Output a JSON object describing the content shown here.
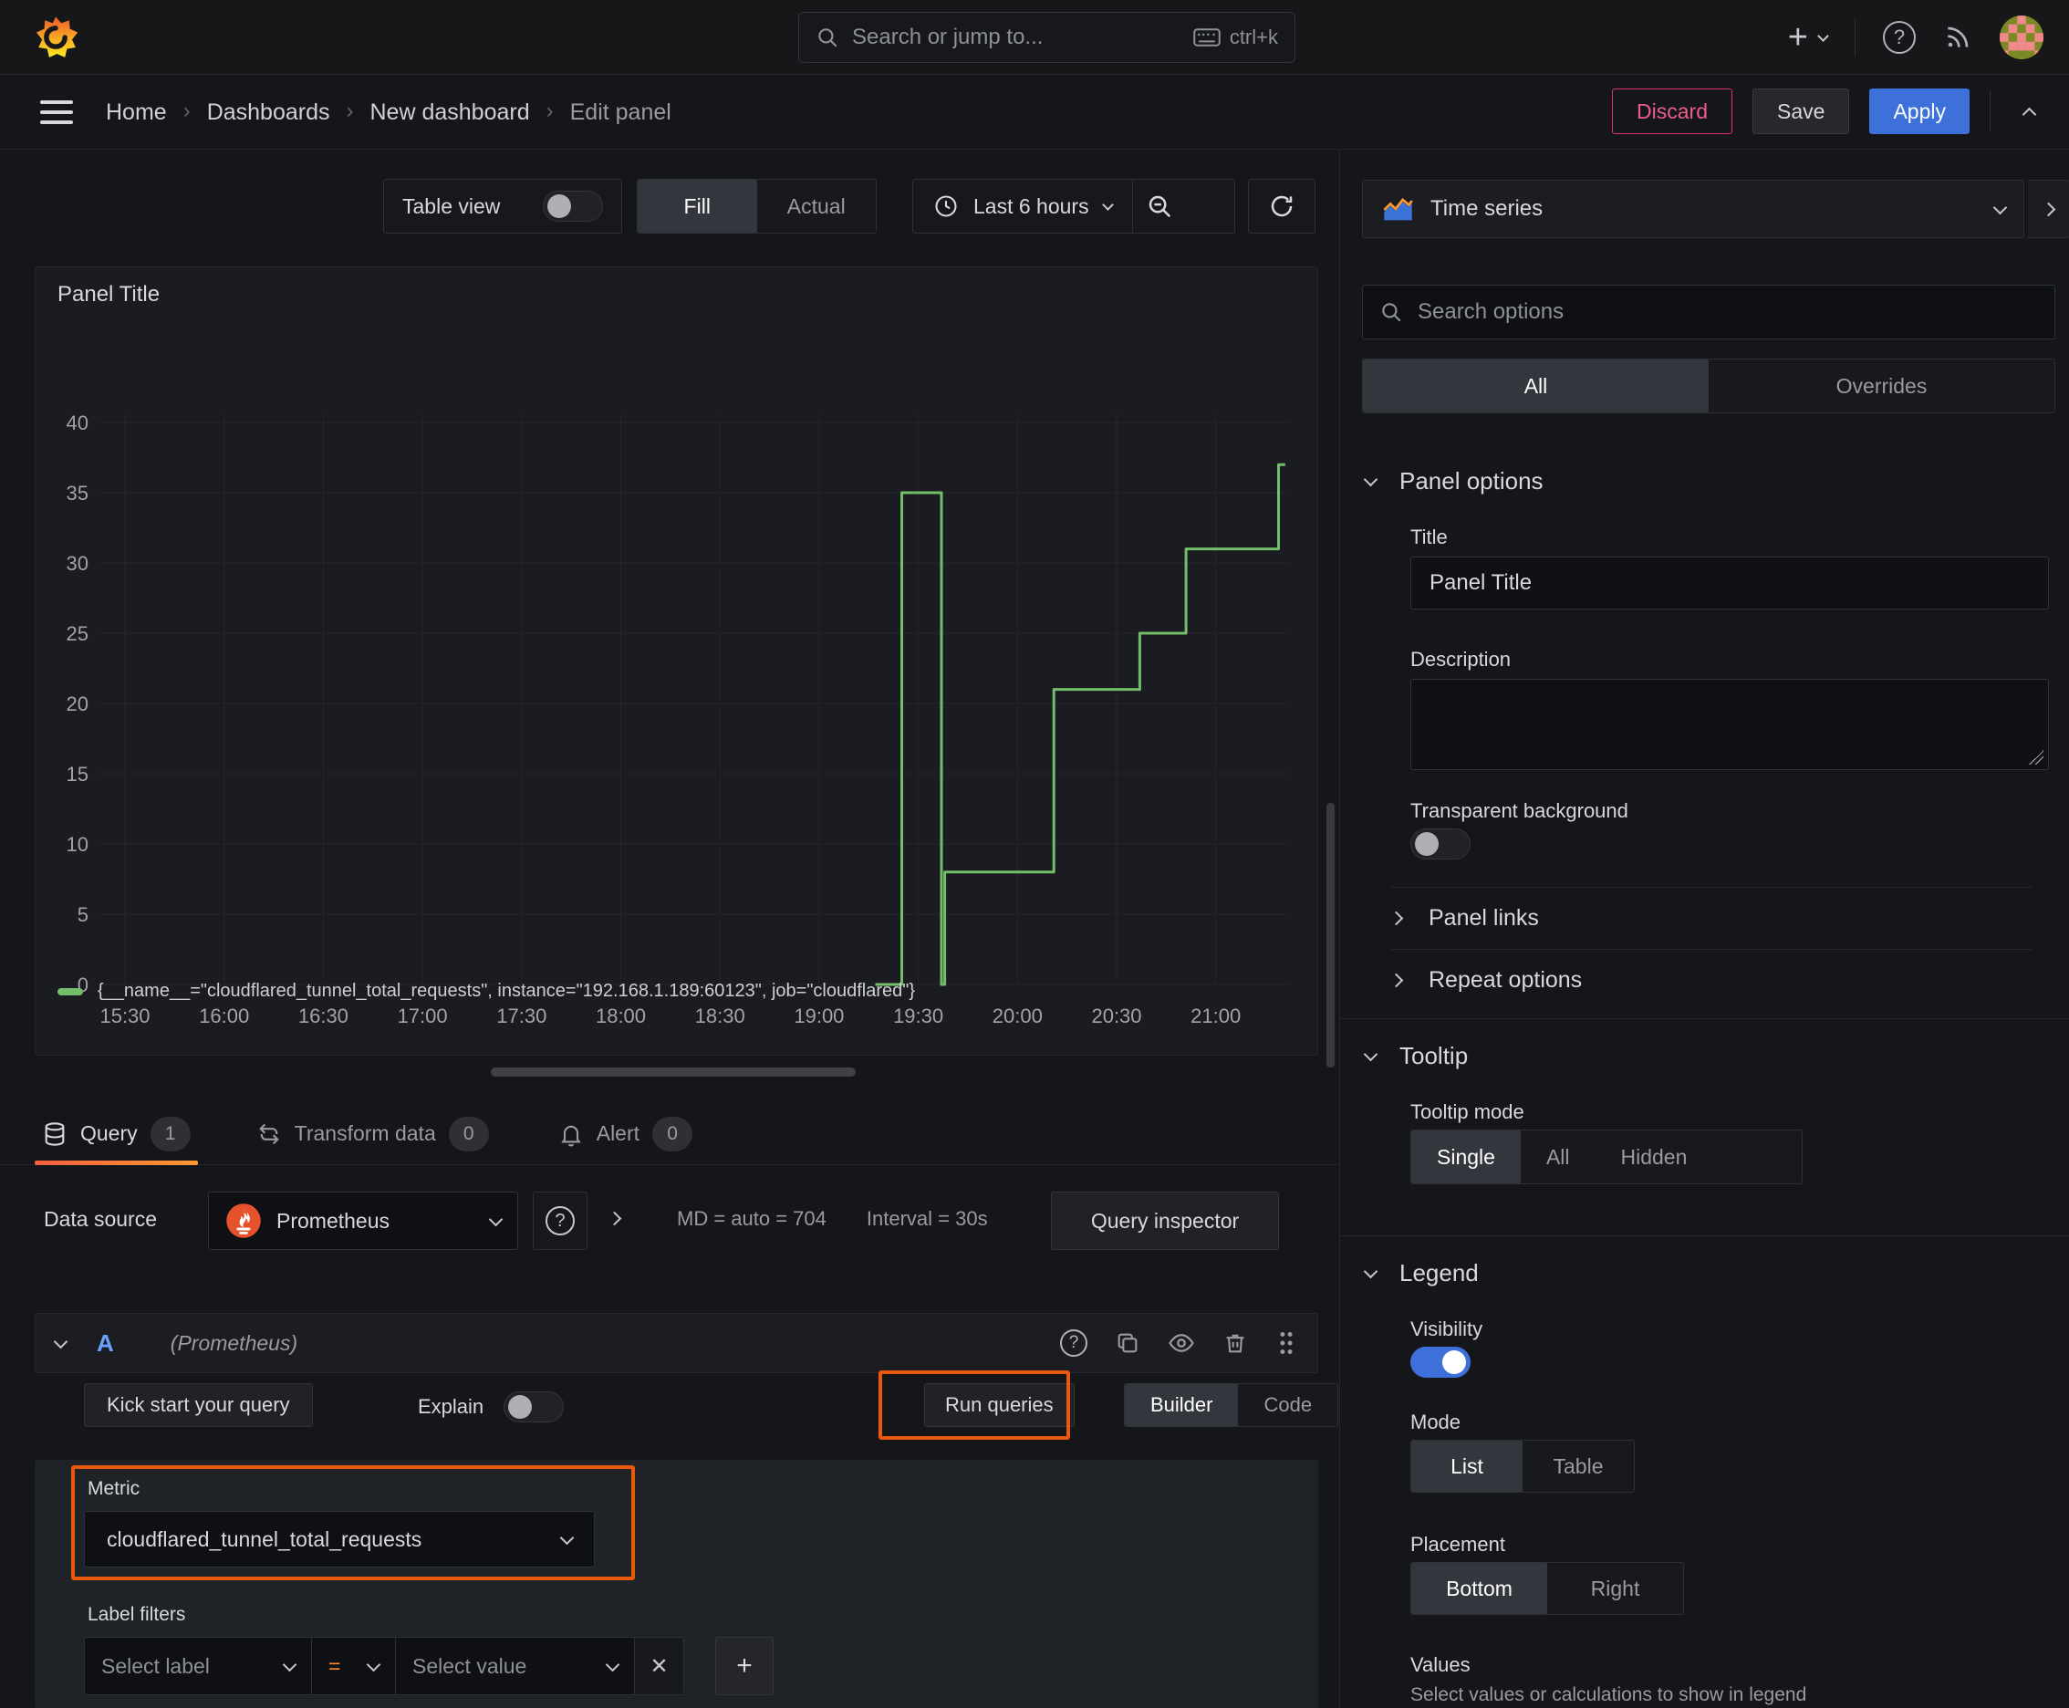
{
  "topnav": {
    "search_placeholder": "Search or jump to...",
    "shortcut": "ctrl+k"
  },
  "breadcrumb": {
    "items": [
      "Home",
      "Dashboards",
      "New dashboard",
      "Edit panel"
    ]
  },
  "actions": {
    "discard": "Discard",
    "save": "Save",
    "apply": "Apply"
  },
  "toolbar": {
    "table_view": "Table view",
    "fill": "Fill",
    "actual": "Actual",
    "time_range": "Last 6 hours"
  },
  "chart_data": {
    "type": "line",
    "title": "Panel Title",
    "xlabel": "",
    "ylabel": "",
    "x_tick_labels": [
      "15:30",
      "16:00",
      "16:30",
      "17:00",
      "17:30",
      "18:00",
      "18:30",
      "19:00",
      "19:30",
      "20:00",
      "20:30",
      "21:00"
    ],
    "x_tick_minutes": [
      0,
      30,
      60,
      90,
      120,
      150,
      180,
      210,
      240,
      270,
      300,
      330
    ],
    "x_range_minutes": [
      -8,
      352
    ],
    "y_ticks": [
      0,
      5,
      10,
      15,
      20,
      25,
      30,
      35,
      40
    ],
    "ylim": [
      0,
      40
    ],
    "grid": true,
    "legend_position": "bottom",
    "series": [
      {
        "name": "{__name__=\"cloudflared_tunnel_total_requests\", instance=\"192.168.1.189:60123\", job=\"cloudflared\"}",
        "color": "#73bf69",
        "points_min_value": [
          [
            227,
            0
          ],
          [
            235,
            0
          ],
          [
            235,
            35
          ],
          [
            247,
            35
          ],
          [
            247,
            0
          ],
          [
            248,
            0
          ],
          [
            248,
            8
          ],
          [
            281,
            8
          ],
          [
            281,
            21
          ],
          [
            307,
            21
          ],
          [
            307,
            25
          ],
          [
            321,
            25
          ],
          [
            321,
            31
          ],
          [
            349,
            31
          ],
          [
            349,
            37
          ],
          [
            351,
            37
          ]
        ]
      }
    ]
  },
  "query_tabs": {
    "query": "Query",
    "query_count": "1",
    "transform": "Transform data",
    "transform_count": "0",
    "alert": "Alert",
    "alert_count": "0"
  },
  "datasource": {
    "label": "Data source",
    "name": "Prometheus",
    "stat_md": "MD = auto = 704",
    "stat_interval": "Interval = 30s",
    "inspector": "Query inspector"
  },
  "query_editor": {
    "ref": "A",
    "ds_hint": "(Prometheus)",
    "kickstart": "Kick start your query",
    "explain": "Explain",
    "run": "Run queries",
    "builder": "Builder",
    "code": "Code",
    "metric_label": "Metric",
    "metric_value": "cloudflared_tunnel_total_requests",
    "label_filters": "Label filters",
    "select_label": "Select label",
    "operator": "=",
    "select_value": "Select value"
  },
  "sidebar": {
    "visualization": "Time series",
    "search_placeholder": "Search options",
    "tab_all": "All",
    "tab_overrides": "Overrides",
    "panel_options": {
      "title": "Panel options",
      "title_label": "Title",
      "title_value": "Panel Title",
      "description_label": "Description",
      "transparent_label": "Transparent background"
    },
    "panel_links": "Panel links",
    "repeat_options": "Repeat options",
    "tooltip": {
      "title": "Tooltip",
      "mode_label": "Tooltip mode",
      "single": "Single",
      "all": "All",
      "hidden": "Hidden"
    },
    "legend": {
      "title": "Legend",
      "visibility_label": "Visibility",
      "mode_label": "Mode",
      "list": "List",
      "table": "Table",
      "placement_label": "Placement",
      "bottom": "Bottom",
      "right": "Right",
      "values_label": "Values",
      "values_help": "Select values or calculations to show in legend"
    }
  },
  "colors": {
    "accent_blue": "#3d71d9",
    "accent_pink": "#e0316e",
    "annotation_orange": "#e8590c",
    "series_green": "#73bf69",
    "tab_gradient_start": "#f55f3e",
    "tab_gradient_end": "#ff9830"
  }
}
